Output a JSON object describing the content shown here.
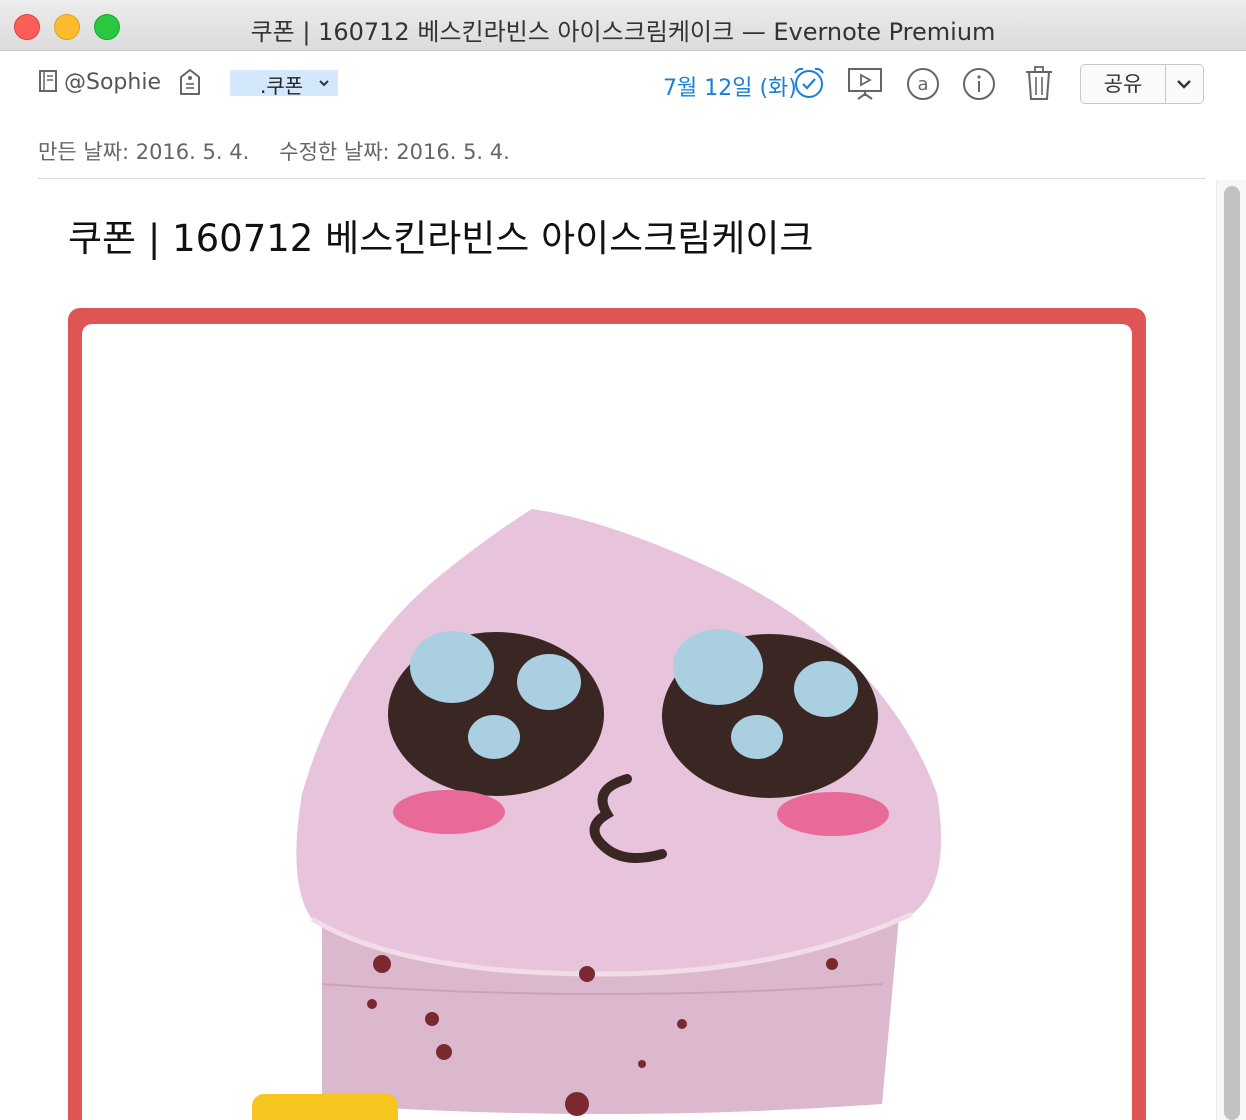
{
  "window": {
    "title": "쿠폰 | 160712 베스킨라빈스 아이스크림케이크 — Evernote Premium"
  },
  "toolbar": {
    "notebook": "@Sophie",
    "tag": ".쿠폰",
    "reminder": "7월 12일 (화)",
    "share_label": "공유"
  },
  "meta": {
    "created": "만든 날짜: 2016. 5. 4.",
    "modified": "수정한 날짜: 2016. 5. 4."
  },
  "note": {
    "title": "쿠폰 | 160712 베스킨라빈스 아이스크림케이크"
  },
  "colors": {
    "coupon_border": "#df5454",
    "reminder_blue": "#1a7fd6",
    "tag_bg": "#d4e8fb",
    "cake_pink": "#e8c3dc"
  },
  "icons": [
    "notebook-icon",
    "tag-icon",
    "chevron-down-icon",
    "alarm-clock-icon",
    "presentation-icon",
    "at-sign-icon",
    "info-icon",
    "trash-icon",
    "chevron-down-icon"
  ]
}
